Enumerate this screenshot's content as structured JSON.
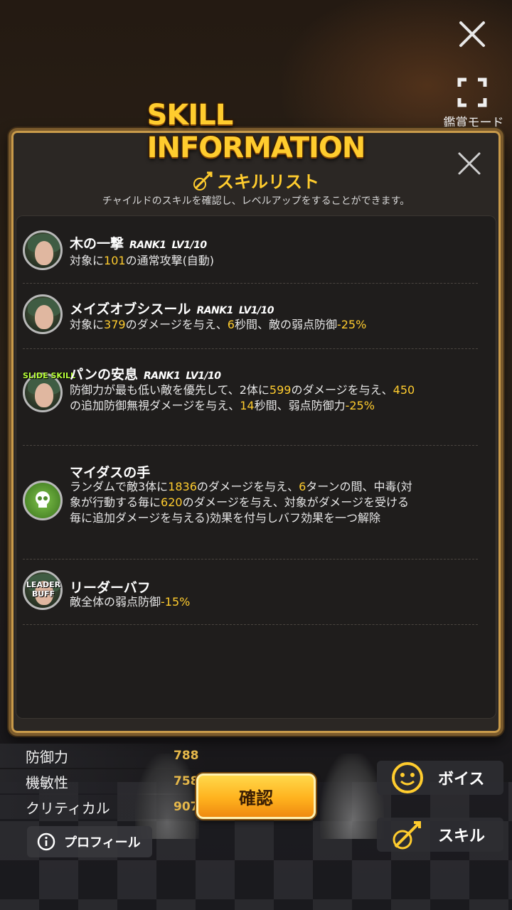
{
  "top_bar": {
    "close_icon": "close-icon",
    "fullscreen_icon": "fullscreen-icon",
    "kansho_label": "鑑賞モード"
  },
  "panel": {
    "title": "SKILL INFORMATION",
    "list_header": "スキルリスト",
    "list_subtitle": "チャイルドのスキルを確認し、レベルアップをすることができます。"
  },
  "skills": [
    {
      "name": "木の一撃",
      "rank": "RANK1",
      "level": "LV1/10",
      "badge": "",
      "desc_parts": [
        "対象に",
        "101",
        "の通常攻撃(自動)"
      ]
    },
    {
      "name": "メイズオブシスール",
      "rank": "RANK1",
      "level": "LV1/10",
      "badge": "",
      "desc_parts": [
        "対象に",
        "379",
        "のダメージを与え、",
        "6",
        "秒間、敵の弱点防御",
        "-25%"
      ]
    },
    {
      "name": "パンの安息",
      "rank": "RANK1",
      "level": "LV1/10",
      "badge": "SLIDE SKILL",
      "desc_parts": [
        "防御力が最も低い敵を優先して、2体に",
        "599",
        "のダメージを与え、",
        "450",
        "の追加防御無視ダメージを与え、",
        "14",
        "秒間、弱点防御力",
        "-25%"
      ]
    },
    {
      "name": "マイダスの手",
      "rank": "",
      "level": "",
      "badge": "",
      "desc_parts": [
        "ランダムで敵3体に",
        "1836",
        "のダメージを与え、",
        "6",
        "ターンの間、中毒(対象が行動する毎に",
        "620",
        "のダメージを与え、対象がダメージを受ける毎に追加ダメージを与える)効果を付与しバフ効果を一つ解除"
      ]
    },
    {
      "name": "リーダーバフ",
      "rank": "",
      "level": "",
      "badge": "LEADER BUFF",
      "desc_parts": [
        "敵全体の弱点防御",
        "-15%"
      ]
    }
  ],
  "stats": [
    {
      "label": "防御力",
      "value": "788"
    },
    {
      "label": "機敏性",
      "value": "758"
    },
    {
      "label": "クリティカル",
      "value": "907"
    }
  ],
  "buttons": {
    "confirm": "確認",
    "voice": "ボイス",
    "skill": "スキル",
    "profile": "プロフィール"
  },
  "colors": {
    "accent": "#ffcc2e",
    "panel_border": "#c89a4a",
    "confirm_button": "#ffb21e"
  }
}
